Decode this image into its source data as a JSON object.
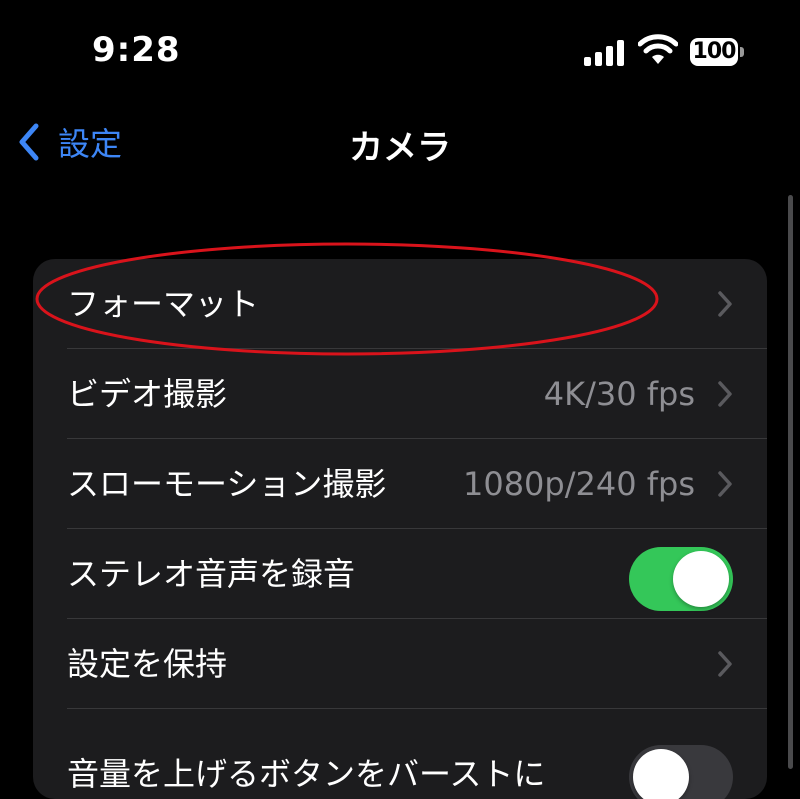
{
  "status_bar": {
    "time": "9:28",
    "battery": "100",
    "signal_icon": "cellular-signal-icon",
    "wifi_icon": "wifi-icon"
  },
  "nav": {
    "back_label": "設定",
    "title": "カメラ"
  },
  "rows": [
    {
      "label": "フォーマット",
      "value": "",
      "type": "disclosure"
    },
    {
      "label": "ビデオ撮影",
      "value": "4K/30 fps",
      "type": "disclosure"
    },
    {
      "label": "スローモーション撮影",
      "value": "1080p/240 fps",
      "type": "disclosure"
    },
    {
      "label": "ステレオ音声を録音",
      "type": "toggle",
      "on": true
    },
    {
      "label": "設定を保持",
      "value": "",
      "type": "disclosure"
    },
    {
      "label": "音量を上げるボタンをバーストに",
      "type": "toggle",
      "on": false
    }
  ],
  "colors": {
    "accent": "#3d86f6",
    "toggle_on": "#34c759",
    "toggle_off": "#39393d",
    "annotation": "#d9131b"
  }
}
